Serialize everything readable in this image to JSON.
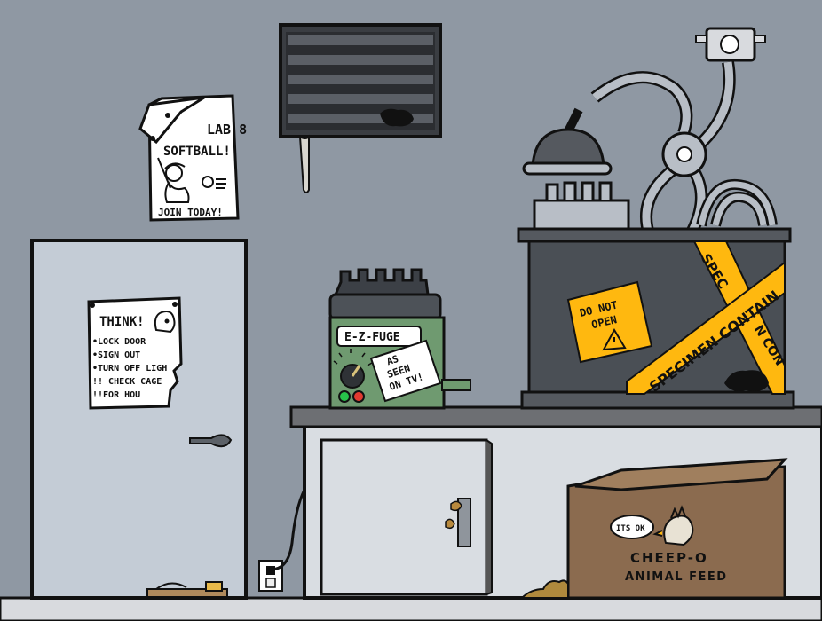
{
  "colors": {
    "wall": "#8f98a3",
    "floor": "#d8dade",
    "door": "#c4ccd6",
    "cabinet": "#d9dde2",
    "counter_top": "#6d6f73",
    "centrifuge_green": "#6f9a70",
    "tank": "#4a4f55",
    "caution_tape": "#ffb80f",
    "box": "#8b6b4f",
    "outline": "#111111"
  },
  "softball_poster": {
    "line1": "LAB 8",
    "line2": "SOFTBALL!",
    "footer": "JOIN TODAY!"
  },
  "think_poster": {
    "title": "THINK!",
    "items": [
      "•LOCK DOOR",
      "•SIGN OUT",
      "•TURN OFF LIGH",
      "!! CHECK CAGE",
      "!!FOR HOU"
    ]
  },
  "centrifuge": {
    "label": "E-Z-FUGE",
    "sticker_line1": "AS",
    "sticker_line2": "SEEN",
    "sticker_line3": "ON TV!"
  },
  "tank": {
    "sign_line1": "DO NOT",
    "sign_line2": "OPEN",
    "tape_text1": "SPECIMEN CONTAIN",
    "tape_text2": "SPEC",
    "tape_text3": "N CON"
  },
  "feed_box": {
    "speech": "ITS OK",
    "line1": "CHEEP-O",
    "line2": "ANIMAL FEED"
  },
  "icons": [
    "warning-icon",
    "chicken-icon",
    "baseball-player-icon",
    "head-icon",
    "outlet-icon",
    "mousetrap-icon"
  ]
}
